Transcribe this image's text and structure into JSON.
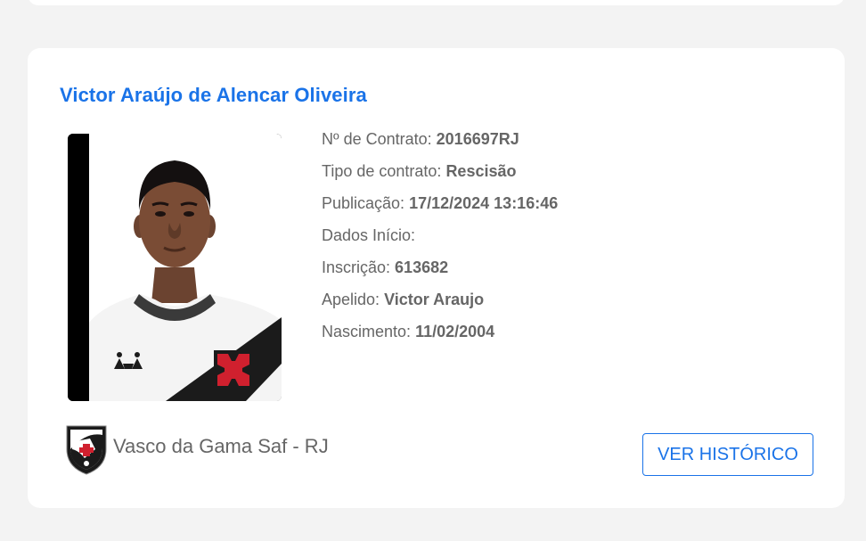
{
  "player": {
    "name": "Victor Araújo de Alencar Oliveira",
    "photo_alt": "Foto do atleta"
  },
  "details": [
    {
      "label": "Nº de Contrato:",
      "value": "2016697RJ"
    },
    {
      "label": "Tipo de contrato:",
      "value": "Rescisão"
    },
    {
      "label": "Publicação:",
      "value": "17/12/2024 13:16:46"
    },
    {
      "label": "Dados Início:",
      "value": ""
    },
    {
      "label": "Inscrição:",
      "value": "613682"
    },
    {
      "label": "Apelido:",
      "value": "Victor Araujo"
    },
    {
      "label": "Nascimento:",
      "value": "11/02/2004"
    }
  ],
  "club": {
    "name": "Vasco da Gama Saf - RJ",
    "crest_icon": "vasco-crest-icon"
  },
  "actions": {
    "history_label": "VER HISTÓRICO"
  },
  "colors": {
    "accent": "#1a73e8",
    "text_muted": "#666666",
    "card_bg": "#ffffff",
    "page_bg": "#f3f3f3",
    "jersey_cross": "#d0202e"
  }
}
